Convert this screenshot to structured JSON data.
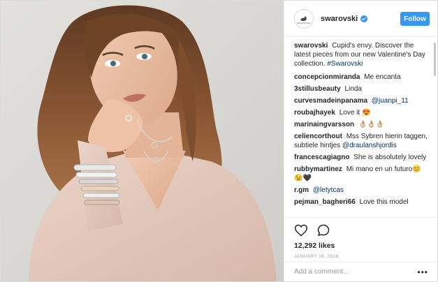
{
  "post": {
    "username": "swarovski",
    "avatar_wordmark": "SWAROVSKI",
    "follow_label": "Follow",
    "caption_user": "swarovski",
    "caption_text": "Cupid's envy. Discover the latest pieces from our new Valentine's Day collection.",
    "caption_hashtag": "#Swarovski",
    "likes": "12,292 likes",
    "date": "JANUARY 16, 2018",
    "comment_placeholder": "Add a comment...",
    "more_label": "•••"
  },
  "comments": [
    {
      "user": "concepcionmiranda",
      "text": "Me encanta",
      "link": ""
    },
    {
      "user": "3stillusbeauty",
      "text": "Linda",
      "link": ""
    },
    {
      "user": "curvesmadeinpanama",
      "text": "",
      "link": "@juanpi_11"
    },
    {
      "user": "roubajhayek",
      "text": "Love it 😍",
      "link": ""
    },
    {
      "user": "marinaingvarsson",
      "text": "👌🏼👌🏼👌🏼",
      "link": ""
    },
    {
      "user": "celiencorthout",
      "text": "Mss Sybren hierin taggen, subtiele hintjes",
      "link": "@draulanshjordis"
    },
    {
      "user": "francescagiagno",
      "text": "She is absolutely lovely",
      "link": ""
    },
    {
      "user": "rubbymartinez",
      "text": "Mi mano en un futuro😊😉🖤",
      "link": ""
    },
    {
      "user": "r.gm",
      "text": "",
      "link": "@letytcas"
    },
    {
      "user": "pejman_bagheri66",
      "text": "Love this model",
      "link": ""
    }
  ],
  "colors": {
    "accent": "#3897f0",
    "link": "#003569",
    "muted": "#999999",
    "photo_background": "#d8d6d3",
    "sweater": "#e3cbbe",
    "hair": "#7a4a2a"
  },
  "icons": {
    "heart": "heart-icon",
    "comment": "comment-icon",
    "verified": "verified-badge-icon",
    "avatar": "swarovski-swan-logo"
  }
}
